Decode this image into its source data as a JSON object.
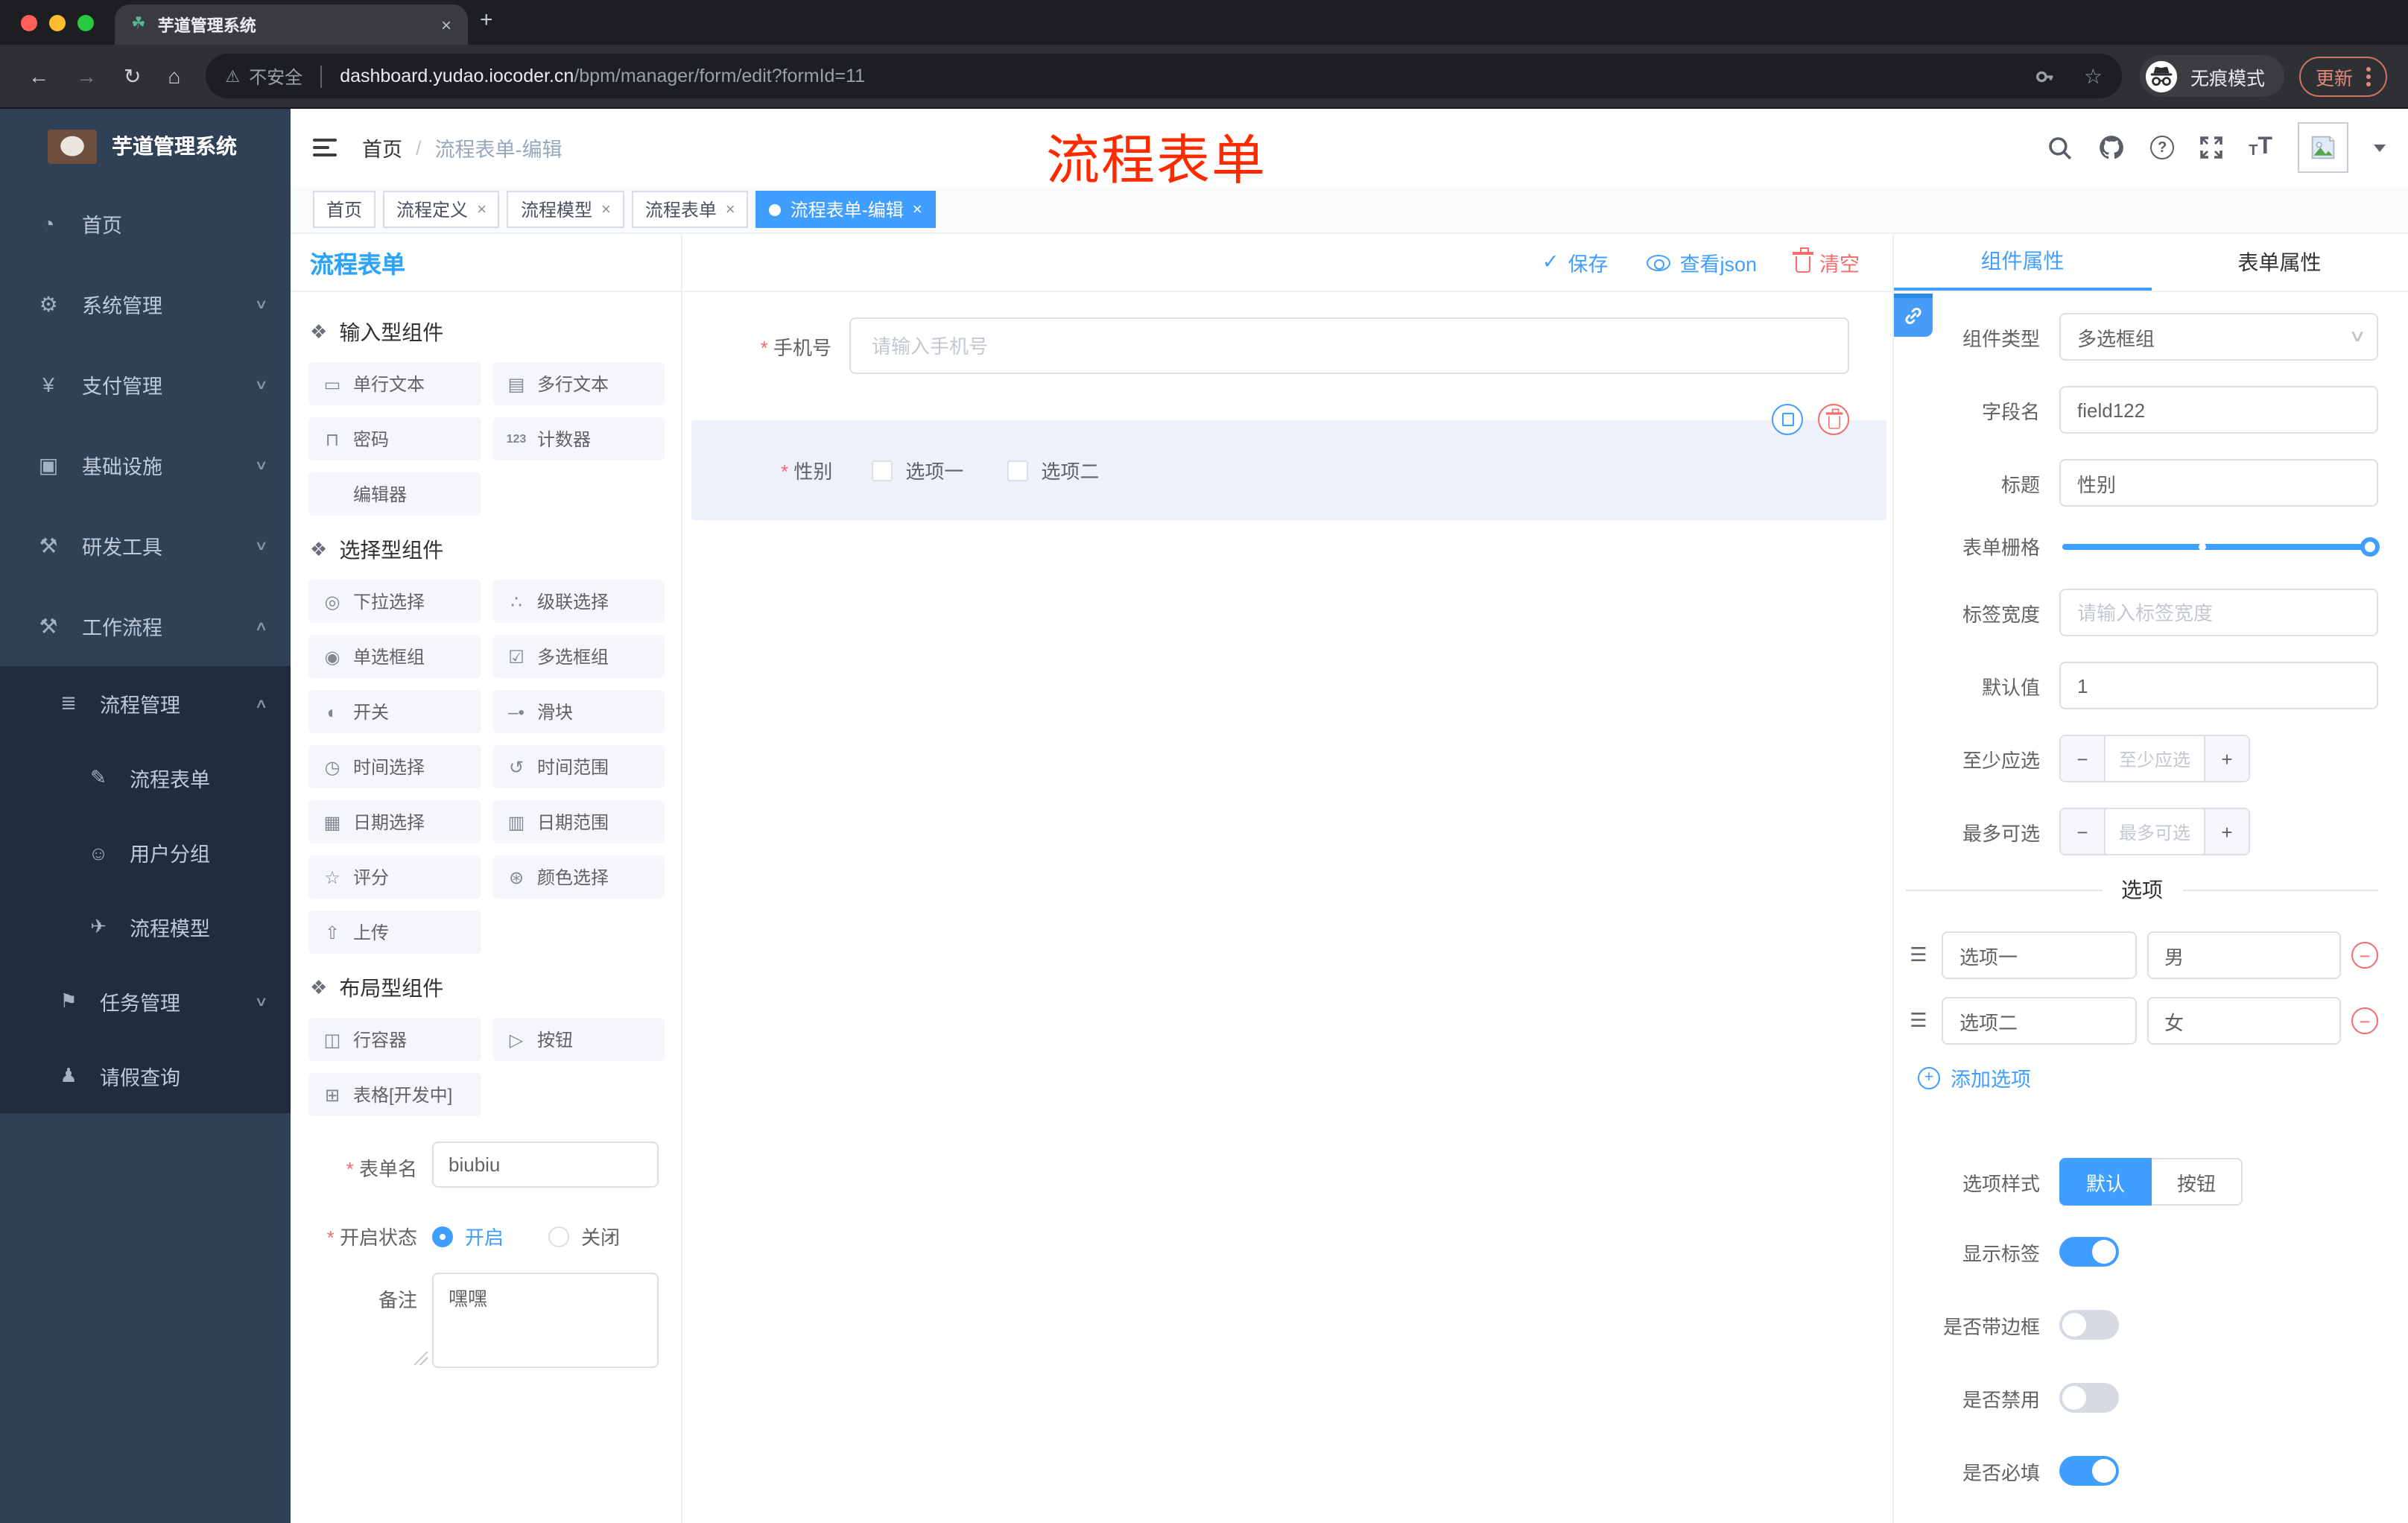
{
  "browser": {
    "tab_title": "芋道管理系统",
    "not_secure": "不安全",
    "url_domain": "dashboard.yudao.iocoder.cn",
    "url_path": "/bpm/manager/form/edit?formId=11",
    "incognito_label": "无痕模式",
    "update_label": "更新"
  },
  "glyphs": {
    "close": "×",
    "new_tab": "+",
    "favicon": "☘",
    "back": "←",
    "forward": "→",
    "reload": "↻",
    "home": "⌂",
    "warning": "⚠",
    "star": "☆",
    "check": "✓",
    "slash": "/",
    "question": "?",
    "minus": "−",
    "plus": "+",
    "chevron_down": "∨",
    "chevron_up": "∧",
    "dot_mark": "●",
    "drag": "☰",
    "select_arrow": "∨",
    "font_small": "T",
    "font_big": "T"
  },
  "colors": {
    "primary": "#409eff",
    "danger": "#f56c6c",
    "annotation_red": "#ff2a00",
    "sidebar_bg": "#304156",
    "submenu_bg": "#1f2d3d",
    "palette_title_blue": "#2ea3f7",
    "traffic_red": "#ff5f57",
    "traffic_yellow": "#febc2e",
    "traffic_green": "#28c840"
  },
  "sidebar": {
    "logo_title": "芋道管理系统",
    "items": [
      {
        "label": "首页",
        "glyph": "◔"
      },
      {
        "label": "系统管理",
        "glyph": "⚙",
        "chevron": "∨"
      },
      {
        "label": "支付管理",
        "glyph": "¥",
        "chevron": "∨"
      },
      {
        "label": "基础设施",
        "glyph": "▣",
        "chevron": "∨"
      },
      {
        "label": "研发工具",
        "glyph": "⚒",
        "chevron": "∨"
      },
      {
        "label": "工作流程",
        "glyph": "⚒",
        "chevron": "∧"
      }
    ],
    "submenu": {
      "group_label": "流程管理",
      "group_glyph": "≣",
      "group_chevron": "∧",
      "children": [
        {
          "label": "流程表单",
          "glyph": "✎"
        },
        {
          "label": "用户分组",
          "glyph": "☺"
        },
        {
          "label": "流程模型",
          "glyph": "✈"
        }
      ],
      "task_label": "任务管理",
      "task_glyph": "⚑",
      "task_chevron": "∨",
      "leave_label": "请假查询",
      "leave_glyph": "♟"
    }
  },
  "header": {
    "breadcrumb_home": "首页",
    "breadcrumb_current": "流程表单-编辑",
    "annotation": "流程表单"
  },
  "tagbar": {
    "tabs": [
      {
        "label": "首页"
      },
      {
        "label": "流程定义"
      },
      {
        "label": "流程模型"
      },
      {
        "label": "流程表单"
      },
      {
        "label": "流程表单-编辑"
      }
    ]
  },
  "palette": {
    "title": "流程表单",
    "groups": [
      {
        "title": "输入型组件",
        "items": [
          {
            "label": "单行文本",
            "glyph": "▭"
          },
          {
            "label": "多行文本",
            "glyph": "▤"
          },
          {
            "label": "密码",
            "glyph": "⊓"
          },
          {
            "label": "计数器",
            "glyph": "123"
          },
          {
            "label": "编辑器",
            "glyph": ""
          }
        ]
      },
      {
        "title": "选择型组件",
        "items": [
          {
            "label": "下拉选择",
            "glyph": "◎"
          },
          {
            "label": "级联选择",
            "glyph": "∴"
          },
          {
            "label": "单选框组",
            "glyph": "◉"
          },
          {
            "label": "多选框组",
            "glyph": "☑"
          },
          {
            "label": "开关",
            "glyph": "◐"
          },
          {
            "label": "滑块",
            "glyph": "–•"
          },
          {
            "label": "时间选择",
            "glyph": "◷"
          },
          {
            "label": "时间范围",
            "glyph": "↺"
          },
          {
            "label": "日期选择",
            "glyph": "▦"
          },
          {
            "label": "日期范围",
            "glyph": "▥"
          },
          {
            "label": "评分",
            "glyph": "☆"
          },
          {
            "label": "颜色选择",
            "glyph": "⊛"
          },
          {
            "label": "上传",
            "glyph": "⇧"
          }
        ]
      },
      {
        "title": "布局型组件",
        "items": [
          {
            "label": "行容器",
            "glyph": "◫"
          },
          {
            "label": "按钮",
            "glyph": "▷"
          },
          {
            "label": "表格[开发中]",
            "glyph": "⊞"
          }
        ]
      }
    ],
    "form": {
      "name_label": "表单名",
      "name_value": "biubiu",
      "status_label": "开启状态",
      "status_on": "开启",
      "status_off": "关闭",
      "remark_label": "备注",
      "remark_value": "嘿嘿"
    }
  },
  "canvas": {
    "save_label": "保存",
    "view_json_label": "查看json",
    "clear_label": "清空",
    "phone": {
      "label": "手机号",
      "placeholder": "请输入手机号"
    },
    "gender": {
      "label": "性别",
      "option1": "选项一",
      "option2": "选项二"
    }
  },
  "inspector": {
    "tab_component": "组件属性",
    "tab_form": "表单属性",
    "type_label": "组件类型",
    "type_value": "多选框组",
    "field_label": "字段名",
    "field_value": "field122",
    "title_label": "标题",
    "title_value": "性别",
    "grid_label": "表单栅格",
    "labelwidth_label": "标签宽度",
    "labelwidth_placeholder": "请输入标签宽度",
    "default_label": "默认值",
    "default_value": "1",
    "min_label": "至少应选",
    "min_placeholder": "至少应选",
    "max_label": "最多可选",
    "max_placeholder": "最多可选",
    "options_divider": "选项",
    "options": [
      {
        "label": "选项一",
        "value": "男"
      },
      {
        "label": "选项二",
        "value": "女"
      }
    ],
    "add_option": "添加选项",
    "style_label": "选项样式",
    "style_default": "默认",
    "style_button": "按钮",
    "toggles": [
      {
        "label": "显示标签",
        "on": true
      },
      {
        "label": "是否带边框",
        "on": false
      },
      {
        "label": "是否禁用",
        "on": false
      },
      {
        "label": "是否必填",
        "on": true
      }
    ]
  }
}
